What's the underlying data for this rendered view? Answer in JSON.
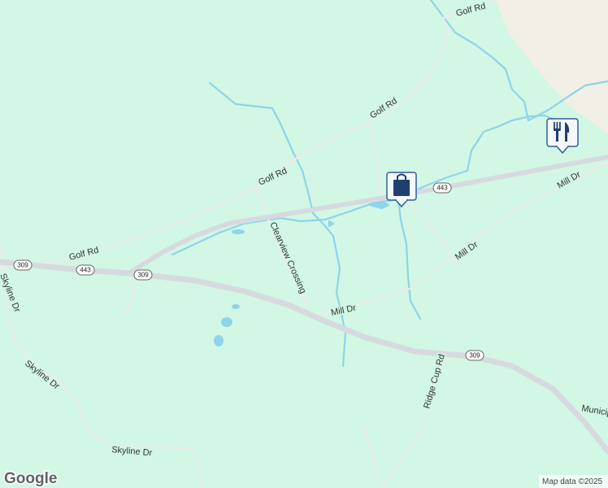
{
  "map": {
    "colors": {
      "land": "#d2f7e4",
      "water": "#8fd4ea",
      "road_minor": "#e9ecec",
      "road_highway": "#d6dadf",
      "urban": "#f2efe6",
      "pin": "#f4f8fc",
      "pin_border": "#2f5d99",
      "pin_icon": "#1f3f6f"
    },
    "road_labels": {
      "golf_rd_top": "Golf Rd",
      "golf_rd_mid": "Golf Rd",
      "golf_rd_west": "Golf Rd",
      "golf_rd_far_west": "Golf Rd",
      "mill_dr_east": "Mill Dr",
      "mill_dr_mid": "Mill Dr",
      "mill_dr_south": "Mill Dr",
      "clearview_crossing": "Clearview Crossing",
      "skyline_dr_far_west": "Skyline Dr",
      "skyline_dr_west": "Skyline Dr",
      "skyline_dr_south": "Skyline Dr",
      "ridge_cup_rd": "Ridge Cup Rd",
      "municipal_partial": "Municip"
    },
    "shields": {
      "rt309_west": "309",
      "rt443_west": "443",
      "rt309_center": "309",
      "rt443_east": "443",
      "rt309_east": "309"
    },
    "pins": {
      "shopping": "shopping-bag-icon",
      "restaurant": "fork-knife-icon"
    },
    "attribution": "Map data ©2025",
    "logo": "Google"
  }
}
